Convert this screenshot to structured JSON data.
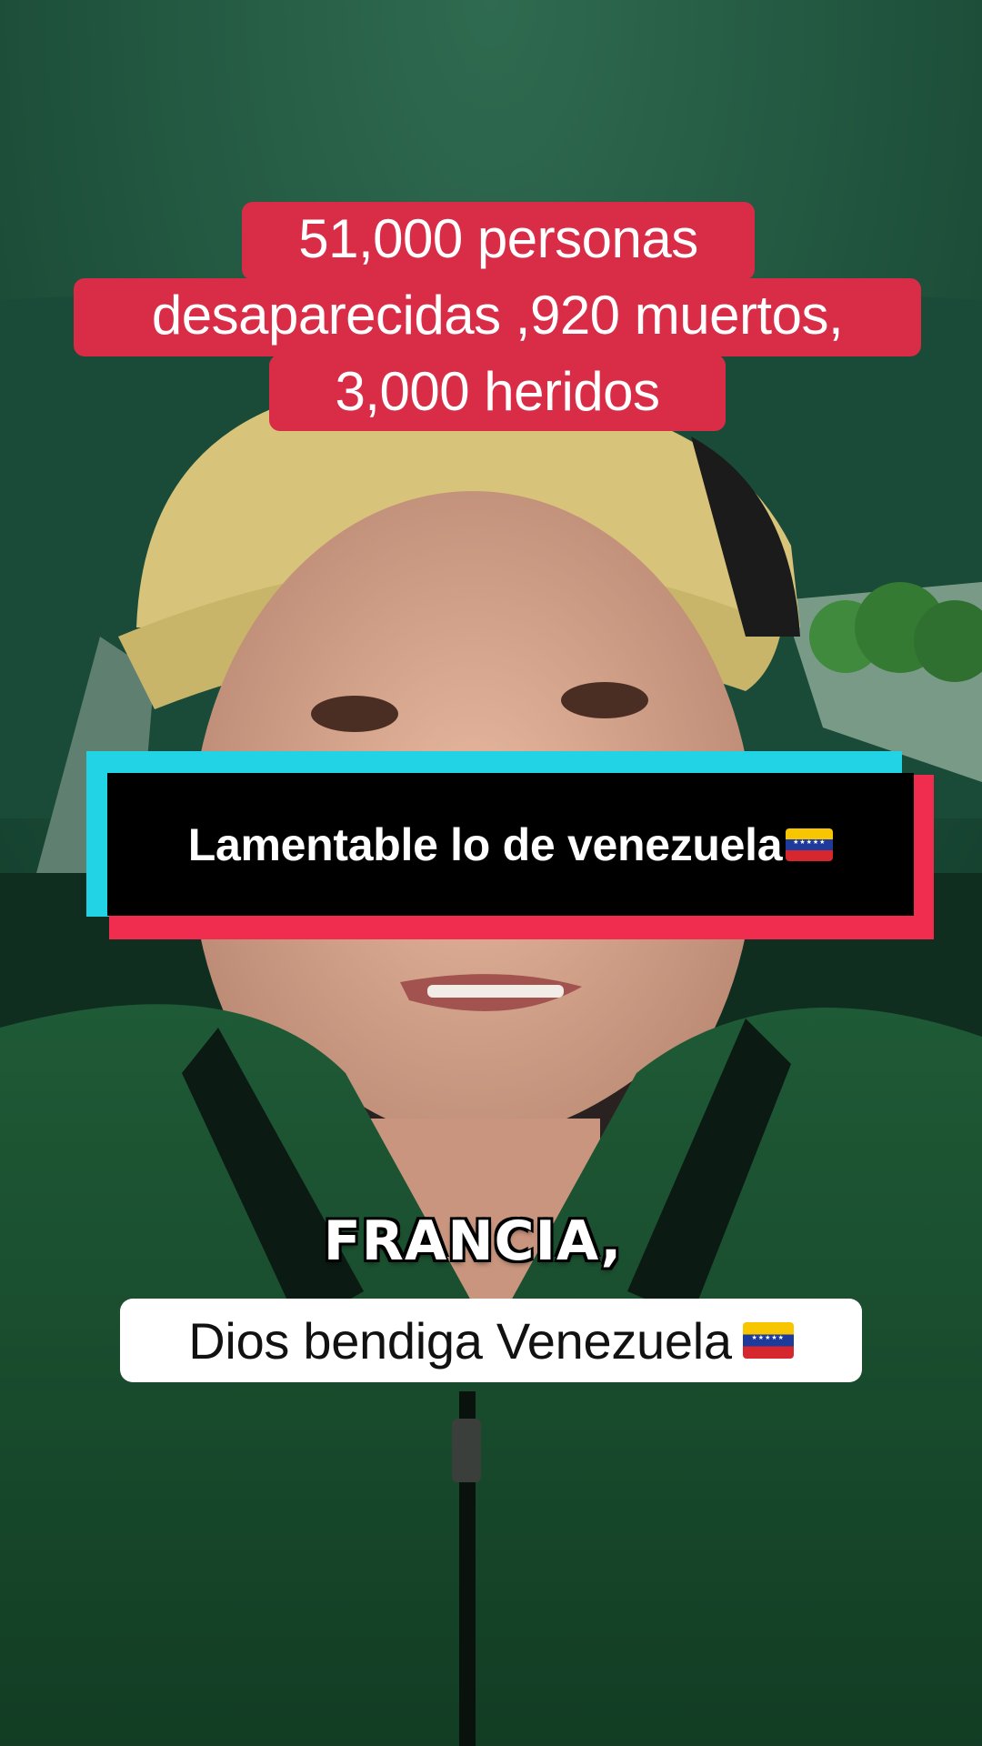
{
  "video": {
    "headline_lines": [
      "51,000 personas",
      "desaparecidas ,920 muertos,",
      "3,000 heridos"
    ],
    "banner_text": "Lamentable lo de venezuela",
    "subtitle": "FRANCIA,",
    "caption": "Dios bendiga Venezuela",
    "flag_icon": "venezuela-flag-icon",
    "colors": {
      "headline_bg": "#d92c46",
      "banner_bg": "#000000",
      "banner_cyan": "#22d3e6",
      "banner_red": "#f02d4e",
      "caption_bg": "#ffffff"
    }
  }
}
